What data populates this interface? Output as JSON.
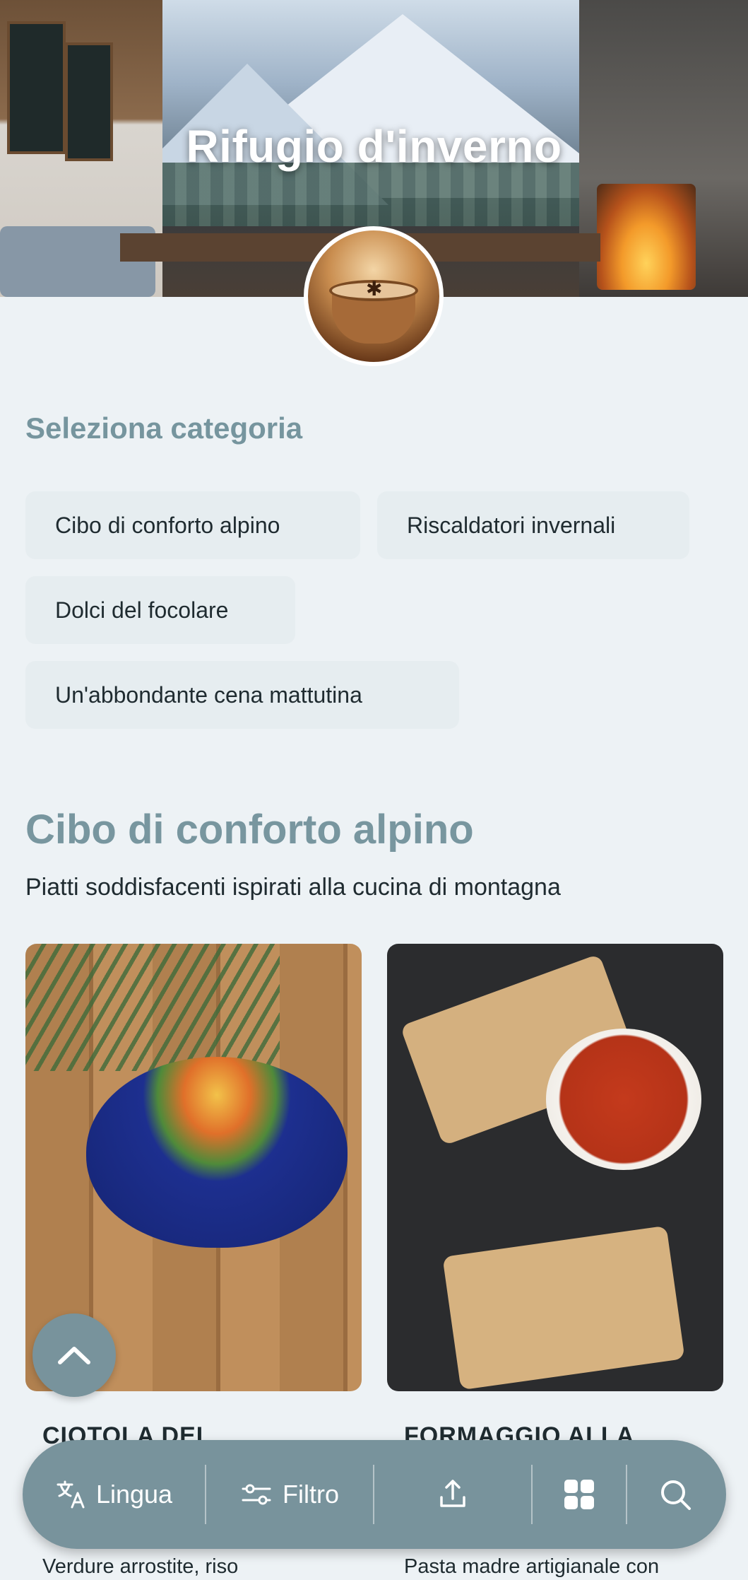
{
  "header": {
    "title": "Rifugio d'inverno"
  },
  "categories_section": {
    "heading": "Seleziona categoria",
    "chips": [
      "Cibo di conforto alpino",
      "Riscaldatori invernali",
      "Dolci del focolare",
      "Un'abbondante cena mattutina"
    ]
  },
  "category": {
    "title": "Cibo di conforto alpino",
    "subtitle": "Piatti soddisfacenti ispirati alla cucina di montagna",
    "items": [
      {
        "title": "CIOTOLA DEL",
        "description": "Verdure arrostite, riso"
      },
      {
        "title": "FORMAGGIO ALLA",
        "description": "Pasta madre artigianale con"
      }
    ]
  },
  "bottom_bar": {
    "language_label": "Lingua",
    "filter_label": "Filtro",
    "icons": [
      "translate-icon",
      "filter-icon",
      "share-icon",
      "grid-icon",
      "search-icon"
    ]
  },
  "colors": {
    "accent": "#78939c",
    "background": "#edf2f5",
    "chip": "#e6edf0"
  }
}
